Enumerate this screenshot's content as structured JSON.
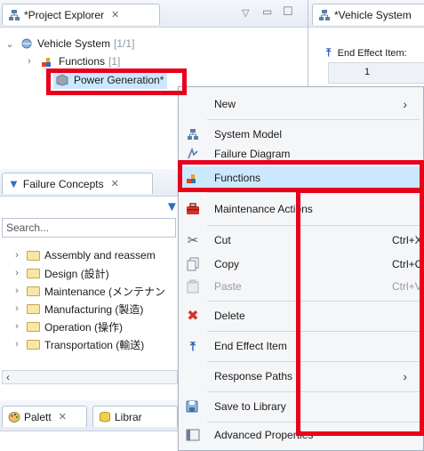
{
  "project_explorer": {
    "tab_title": "*Project Explorer",
    "tree": {
      "root_label": "Vehicle System",
      "root_count": "[1/1]",
      "child1_label": "Functions",
      "child1_count": "[1]",
      "child2_label": "Power Generation*"
    }
  },
  "editor": {
    "tab_title": "*Vehicle System",
    "end_effect_label": "End Effect Item:",
    "column_value": "1"
  },
  "failure_concepts": {
    "tab_title": "Failure Concepts",
    "search_placeholder": "Search...",
    "items": [
      "Assembly and reassem",
      "Design (設計)",
      "Maintenance (メンテナン",
      "Manufacturing (製造)",
      "Operation (操作)",
      "Transportation (輸送)"
    ]
  },
  "bottom_tabs": {
    "palette": "Palett",
    "library": "Librar"
  },
  "context_menu": {
    "new": "New",
    "system_model": "System Model",
    "failure_diagram": "Failure Diagram",
    "functions": "Functions",
    "maintenance_actions": "Maintenance Actions",
    "cut": "Cut",
    "cut_shortcut": "Ctrl+X",
    "copy": "Copy",
    "copy_shortcut": "Ctrl+C",
    "paste": "Paste",
    "paste_shortcut": "Ctrl+V",
    "delete": "Delete",
    "end_effect_item": "End Effect Item",
    "response_paths": "Response Paths",
    "save_to_library": "Save to Library",
    "advanced_properties": "Advanced Properties"
  },
  "colors": {
    "highlight": "#e8001c",
    "selected_item": "#cce8ff",
    "menu_background": "#f5f6f8"
  }
}
